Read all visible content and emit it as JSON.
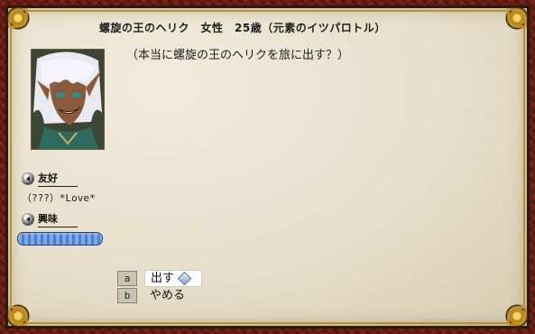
{
  "header": {
    "title": "螺旋の王のヘリク　女性　25歳（元素のイツパロトル）"
  },
  "dialogue": {
    "text": "（本当に螺旋の王のヘリクを旅に出す？）"
  },
  "portrait": {
    "icon": "character-portrait"
  },
  "relationship": {
    "label": "友好",
    "value": "（???）*Love*"
  },
  "interest": {
    "label": "興味",
    "level": 1.0
  },
  "choices": [
    {
      "key": "a",
      "label": "出す",
      "selected": true
    },
    {
      "key": "b",
      "label": "やめる",
      "selected": false
    }
  ],
  "colors": {
    "frame_gold": "#b8912f",
    "parchment": "#e7dfcb",
    "backdrop": "#6a1e16",
    "interest_bar": "#4d7ccc"
  }
}
